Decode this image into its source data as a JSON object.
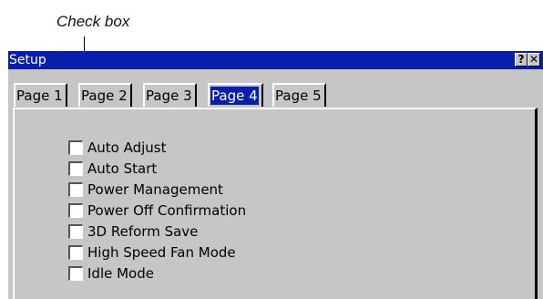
{
  "annotation": {
    "label": "Check box"
  },
  "window": {
    "title": "Setup",
    "help_button": "?",
    "close_button": "✕"
  },
  "tabs": [
    {
      "label": "Page 1",
      "selected": false
    },
    {
      "label": "Page 2",
      "selected": false
    },
    {
      "label": "Page 3",
      "selected": false
    },
    {
      "label": "Page 4",
      "selected": true
    },
    {
      "label": "Page 5",
      "selected": false
    }
  ],
  "options": [
    {
      "label": "Auto Adjust",
      "checked": false
    },
    {
      "label": "Auto Start",
      "checked": false
    },
    {
      "label": "Power Management",
      "checked": false
    },
    {
      "label": "Power Off Confirmation",
      "checked": false
    },
    {
      "label": "3D Reform Save",
      "checked": false
    },
    {
      "label": "High Speed Fan Mode",
      "checked": false
    },
    {
      "label": "Idle Mode",
      "checked": false
    }
  ]
}
